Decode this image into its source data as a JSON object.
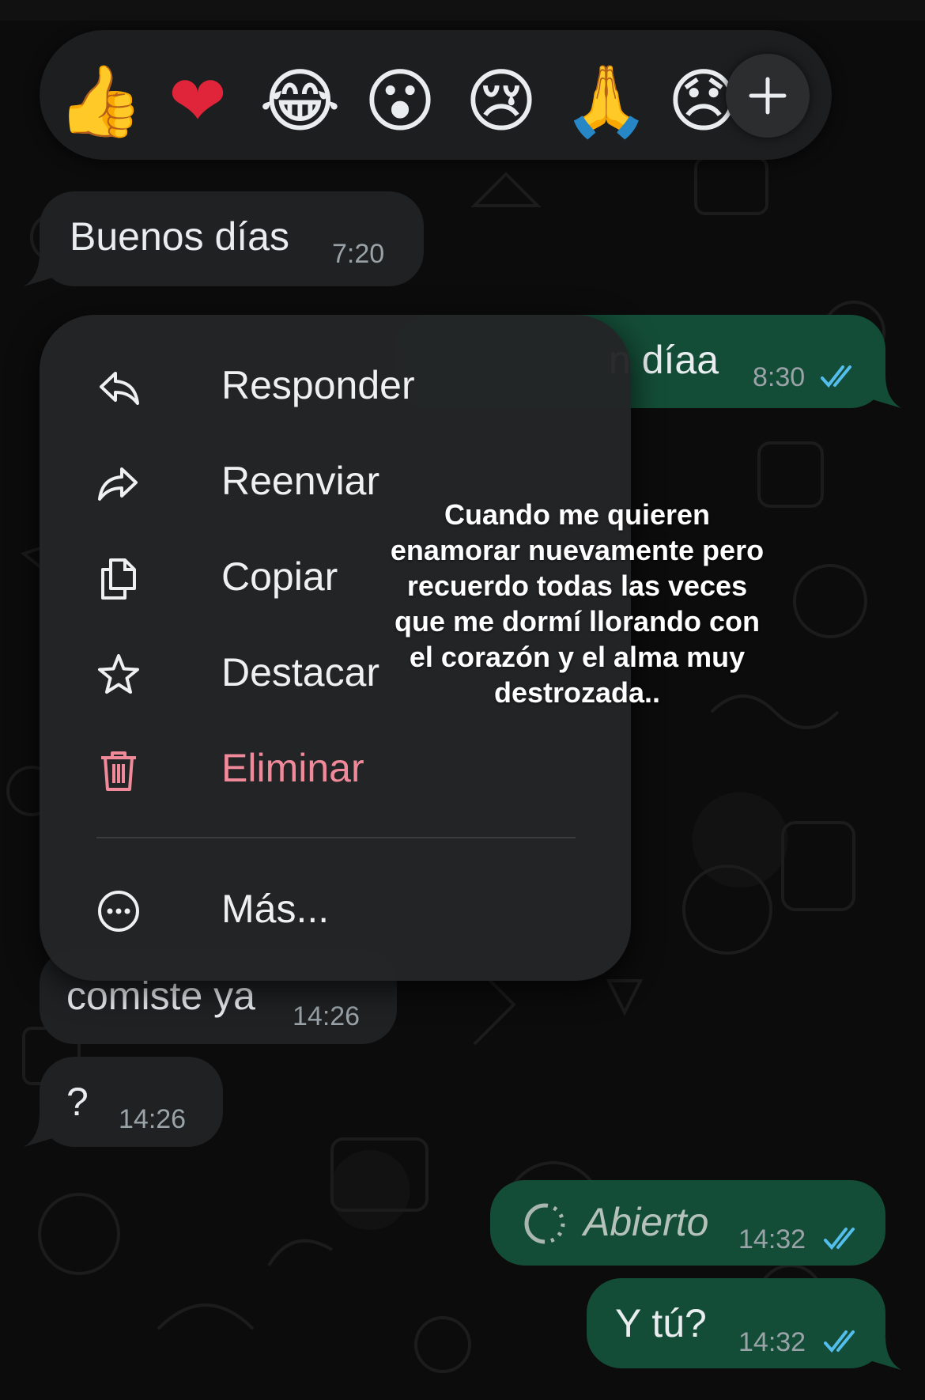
{
  "reactions": {
    "emojis": [
      "👍",
      "❤",
      "😂",
      "😮",
      "😢",
      "🙏",
      "😞"
    ],
    "names": [
      "thumbs-up-icon",
      "heart-icon",
      "laughing-icon",
      "surprised-icon",
      "crying-icon",
      "pray-icon",
      "disappointed-icon"
    ],
    "more_icon": "plus-icon"
  },
  "messages": [
    {
      "direction": "in",
      "text": "Buenos días",
      "time": "7:20"
    },
    {
      "direction": "out",
      "text": "n díaa",
      "time": "8:30",
      "read": true
    },
    {
      "direction": "in",
      "text": "comiste ya",
      "time": "14:26"
    },
    {
      "direction": "in",
      "text": "?",
      "time": "14:26"
    },
    {
      "direction": "out",
      "text": "Abierto",
      "time": "14:32",
      "read": true,
      "icon": "view-once-icon"
    },
    {
      "direction": "out",
      "text": "Y tú?",
      "time": "14:32",
      "read": true
    }
  ],
  "menu": {
    "items": [
      {
        "label": "Responder",
        "icon": "reply-icon"
      },
      {
        "label": "Reenviar",
        "icon": "forward-icon"
      },
      {
        "label": "Copiar",
        "icon": "copy-icon"
      },
      {
        "label": "Destacar",
        "icon": "star-icon"
      },
      {
        "label": "Eliminar",
        "icon": "trash-icon",
        "danger": true
      },
      {
        "label": "Más...",
        "icon": "more-icon"
      }
    ]
  },
  "overlay_caption": "Cuando me quieren enamorar nuevamente pero recuerdo todas las veces que me dormí llorando con el corazón y el alma muy destrozada..",
  "colors": {
    "incoming_bubble": "#1f2123",
    "outgoing_bubble": "#144d37",
    "read_ticks": "#53bdeb",
    "danger": "#f08a9a",
    "menu_bg": "#242527"
  }
}
